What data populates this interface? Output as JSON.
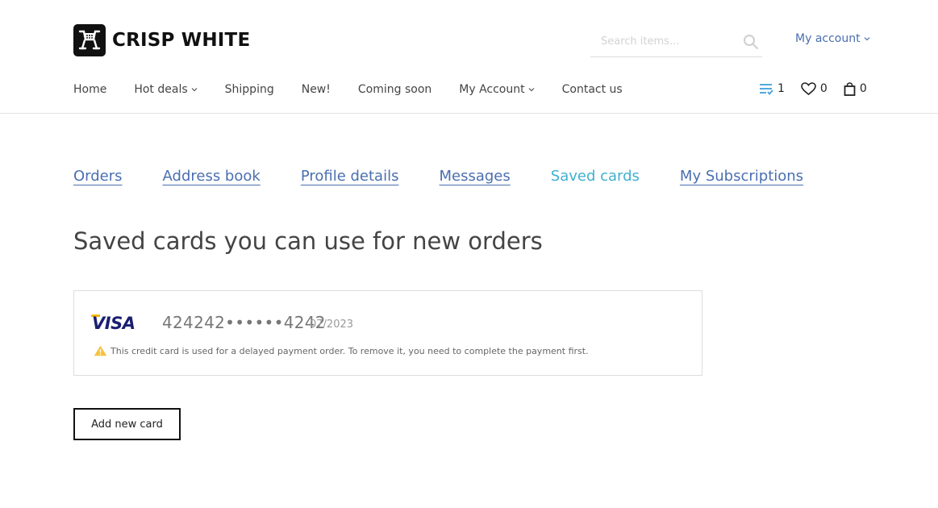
{
  "brand": {
    "name": "CRISP WHITE"
  },
  "search": {
    "placeholder": "Search items..."
  },
  "account_menu": {
    "label": "My account"
  },
  "main_nav": {
    "items": [
      {
        "label": "Home",
        "has_dropdown": false
      },
      {
        "label": "Hot deals",
        "has_dropdown": true
      },
      {
        "label": "Shipping",
        "has_dropdown": false
      },
      {
        "label": "New!",
        "has_dropdown": false
      },
      {
        "label": "Coming soon",
        "has_dropdown": false
      },
      {
        "label": "My Account",
        "has_dropdown": true
      },
      {
        "label": "Contact us",
        "has_dropdown": false
      }
    ]
  },
  "header_icons": {
    "list_count": "1",
    "wishlist_count": "0",
    "cart_count": "0"
  },
  "account_tabs": [
    {
      "label": "Orders",
      "active": false
    },
    {
      "label": "Address book",
      "active": false
    },
    {
      "label": "Profile details",
      "active": false
    },
    {
      "label": "Messages",
      "active": false
    },
    {
      "label": "Saved cards",
      "active": true
    },
    {
      "label": "My Subscriptions",
      "active": false
    }
  ],
  "page": {
    "title": "Saved cards you can use for new orders"
  },
  "saved_card": {
    "brand": "VISA",
    "number": "424242••••••4242",
    "expiry": "07/2023",
    "warning": "This credit card is used for a delayed payment order. To remove it, you need to complete the payment first."
  },
  "actions": {
    "add_card_label": "Add new card"
  },
  "colors": {
    "link": "#4a6fb0",
    "active_tab": "#3fb0d0",
    "list_icon": "#3fa0d8",
    "warning_icon": "#f5c242",
    "visa_blue": "#1a1f71"
  }
}
